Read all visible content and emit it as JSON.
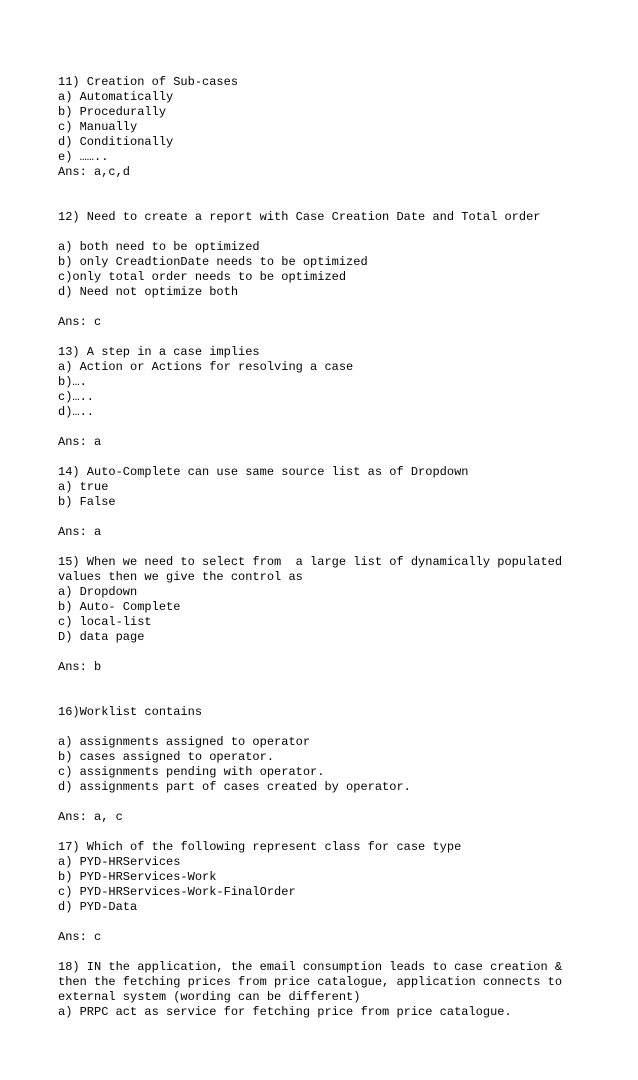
{
  "document_text": "11) Creation of Sub-cases\na) Automatically\nb) Procedurally\nc) Manually\nd) Conditionally\ne) ……..\nAns: a,c,d\n\n\n12) Need to create a report with Case Creation Date and Total order\n\na) both need to be optimized\nb) only CreadtionDate needs to be optimized\nc)only total order needs to be optimized\nd) Need not optimize both\n\nAns: c\n\n13) A step in a case implies\na) Action or Actions for resolving a case\nb)….\nc)…..\nd)…..\n\nAns: a\n\n14) Auto-Complete can use same source list as of Dropdown\na) true\nb) False\n\nAns: a\n\n15) When we need to select from  a large list of dynamically populated values then we give the control as\na) Dropdown\nb) Auto- Complete\nc) local-list\nD) data page\n\nAns: b\n\n\n16)Worklist contains\n\na) assignments assigned to operator\nb) cases assigned to operator.\nc) assignments pending with operator.\nd) assignments part of cases created by operator.\n\nAns: a, c\n\n17) Which of the following represent class for case type\na) PYD-HRServices\nb) PYD-HRServices-Work\nc) PYD-HRServices-Work-FinalOrder\nd) PYD-Data\n\nAns: c\n\n18) IN the application, the email consumption leads to case creation & then the fetching prices from price catalogue, application connects to external system (wording can be different)\na) PRPC act as service for fetching price from price catalogue."
}
